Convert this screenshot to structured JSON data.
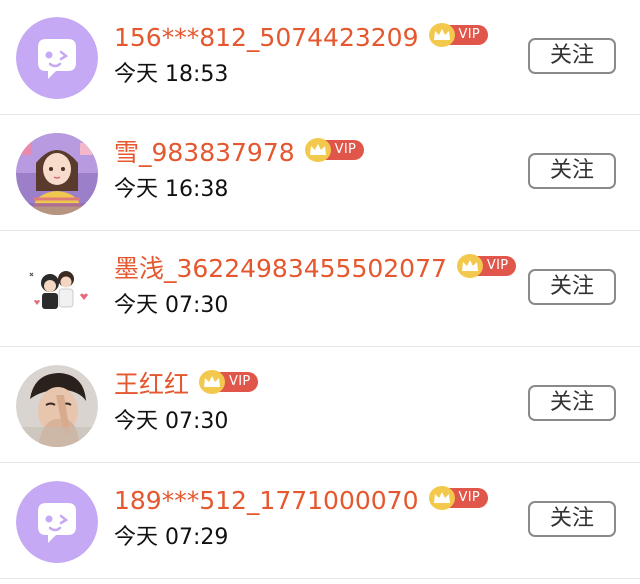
{
  "vip_badge_text": "VIP",
  "follow_label": "关注",
  "colors": {
    "username": "#e5572f",
    "vip_red": "#e1564a",
    "vip_gold": "#f2c94c",
    "default_avatar_bg": "#c6a9f5"
  },
  "users": [
    {
      "username": "156***812_5074423209",
      "time": "今天 18:53",
      "avatar": "default-chat-avatar"
    },
    {
      "username": "雪_983837978",
      "time": "今天 16:38",
      "avatar": "girl-illustration-avatar"
    },
    {
      "username": "墨浅_36224983455502077",
      "time": "今天 07:30",
      "avatar": "couple-sticker-avatar"
    },
    {
      "username": "王红红",
      "time": "今天 07:30",
      "avatar": "man-photo-avatar"
    },
    {
      "username": "189***512_1771000070",
      "time": "今天 07:29",
      "avatar": "default-chat-avatar"
    }
  ]
}
